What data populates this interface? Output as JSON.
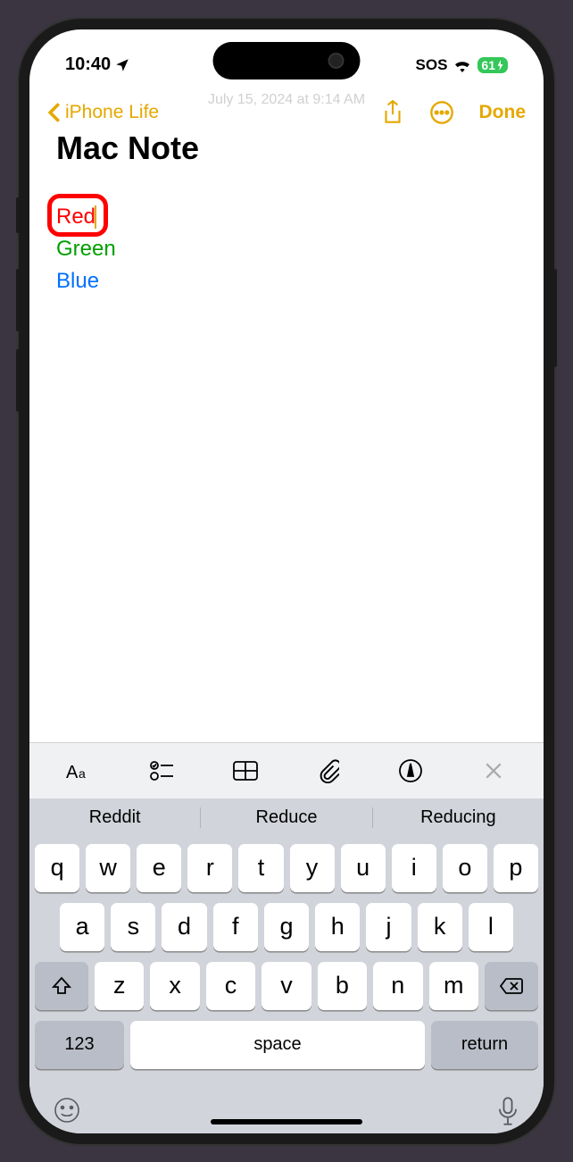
{
  "status": {
    "time": "10:40",
    "sos": "SOS",
    "battery": "61"
  },
  "nav": {
    "back_label": "iPhone Life",
    "done_label": "Done"
  },
  "note": {
    "title": "Mac Note",
    "faded_date": "July 15, 2024 at 9:14 AM",
    "lines": {
      "red": "Red",
      "green": "Green",
      "blue": "Blue"
    }
  },
  "predictions": [
    "Reddit",
    "Reduce",
    "Reducing"
  ],
  "keyboard": {
    "row1": [
      "q",
      "w",
      "e",
      "r",
      "t",
      "y",
      "u",
      "i",
      "o",
      "p"
    ],
    "row2": [
      "a",
      "s",
      "d",
      "f",
      "g",
      "h",
      "j",
      "k",
      "l"
    ],
    "row3": [
      "z",
      "x",
      "c",
      "v",
      "b",
      "n",
      "m"
    ],
    "num_key": "123",
    "space_key": "space",
    "return_key": "return"
  }
}
